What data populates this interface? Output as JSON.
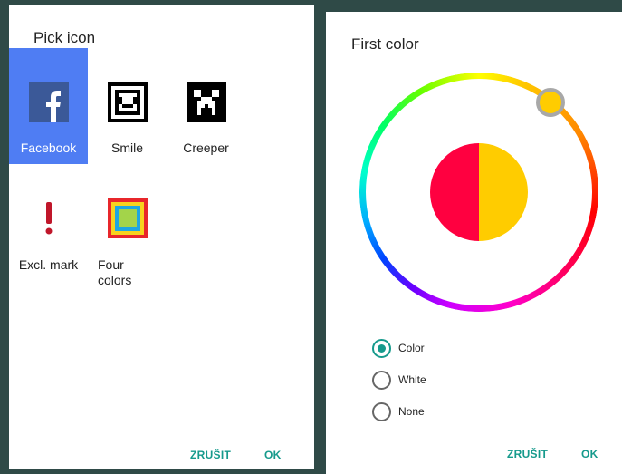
{
  "left_dialog": {
    "title": "Pick icon",
    "icons": [
      {
        "label": "Facebook",
        "icon": "facebook-icon",
        "selected": true
      },
      {
        "label": "Smile",
        "icon": "smile-icon",
        "selected": false
      },
      {
        "label": "Creeper",
        "icon": "creeper-icon",
        "selected": false
      },
      {
        "label": "Excl. mark",
        "icon": "exclamation-icon",
        "selected": false
      },
      {
        "label": "Four\ncolors",
        "icon": "four-colors-icon",
        "selected": false
      }
    ],
    "cancel_label": "ZRUŠIT",
    "ok_label": "OK"
  },
  "right_dialog": {
    "title": "First color",
    "preview_colors": {
      "left": "#ff0040",
      "right": "#ffcc00"
    },
    "selected_hue_color": "#ffcc00",
    "radio_options": [
      {
        "label": "Color",
        "checked": true
      },
      {
        "label": "White",
        "checked": false
      },
      {
        "label": "None",
        "checked": false
      }
    ],
    "cancel_label": "ZRUŠIT",
    "ok_label": "OK"
  },
  "colors": {
    "accent": "#169a8c",
    "selection": "#4f7df3",
    "facebook_blue": "#3b5998",
    "exclamation_red": "#c0162a"
  }
}
